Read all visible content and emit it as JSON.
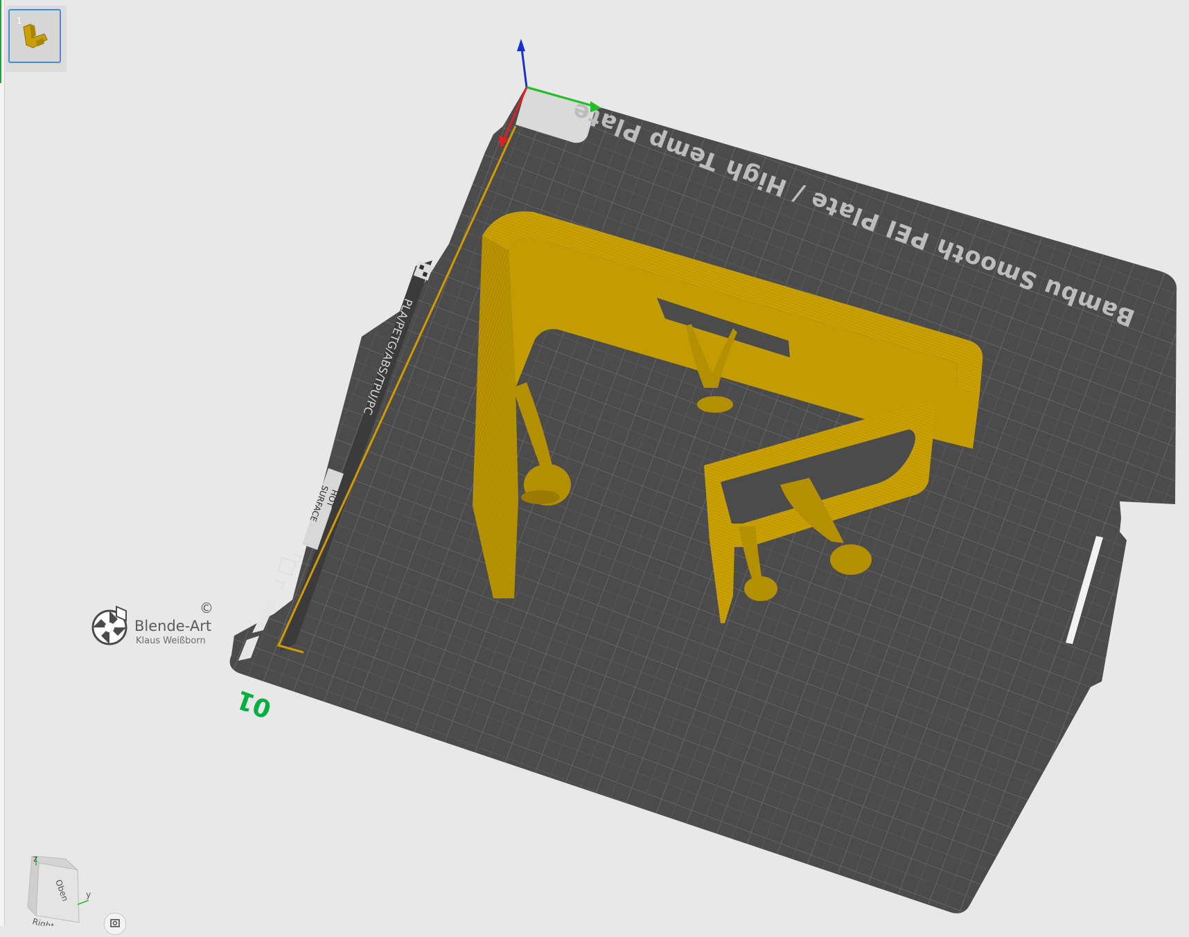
{
  "plate_list": {
    "items": [
      {
        "index": "1",
        "selected": true
      }
    ]
  },
  "build_plate": {
    "title": "Bambu Smooth PEI Plate / High Temp Plate",
    "materials_label": "PLA/PETG/ABS/TPU/PC",
    "hot_surface_line1": "HOT",
    "hot_surface_line2": "SURFACE",
    "plate_number": "01",
    "plate_color": "#4a4b4a",
    "grid_color": "#6a6b6a",
    "model_color": "#c9a003"
  },
  "axes": {
    "x_color": "#e02020",
    "y_color": "#1fc01f",
    "z_color": "#1830d0"
  },
  "watermark": {
    "title": "Blende-Art",
    "subtitle": "Klaus Weißborn",
    "copyright": "©"
  },
  "view_cube": {
    "top_label": "Oben",
    "front_label": "Right",
    "axis_z": "z",
    "axis_y": "y"
  },
  "icons": {
    "thumbnail": "plate-thumbnail-icon",
    "view_cube": "view-cube-icon",
    "reset_view": "reset-view-icon"
  }
}
